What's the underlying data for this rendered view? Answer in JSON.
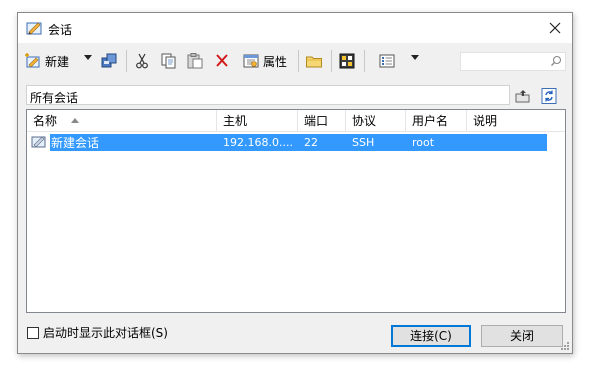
{
  "window": {
    "title": "会话"
  },
  "toolbar": {
    "new_label": "新建",
    "properties_label": "属性",
    "search": {
      "placeholder": "",
      "value": ""
    },
    "icons": [
      "new-session-icon",
      "dropdown-arrow-icon",
      "sessions-copy-icon",
      "cut-icon",
      "copy-icon",
      "paste-icon",
      "delete-icon",
      "properties-icon",
      "folder-icon",
      "script-icon",
      "view-icon",
      "dropdown-arrow-icon",
      "search-icon"
    ]
  },
  "path": {
    "text": "所有会话"
  },
  "table": {
    "columns": [
      "名称",
      "主机",
      "端口",
      "协议",
      "用户名",
      "说明"
    ],
    "sort_column": "名称",
    "sort_direction": "ascending",
    "rows": [
      {
        "name": "新建会话",
        "host": "192.168.0....",
        "port": "22",
        "protocol": "SSH",
        "user": "root",
        "description": "",
        "selected": true
      }
    ]
  },
  "footer": {
    "startup_label": "启动时显示此对话框(S)",
    "startup_checked": false,
    "connect_label": "连接(C)",
    "close_label": "关闭"
  },
  "colors": {
    "selection": "#3399ff",
    "default_button_border": "#0078d7"
  }
}
